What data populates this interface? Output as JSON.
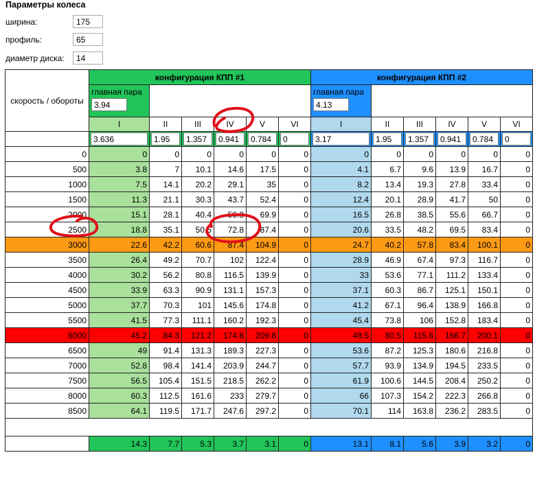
{
  "wheel_params": {
    "title": "Параметры колеса",
    "fields": [
      {
        "label": "ширина:",
        "value": "175"
      },
      {
        "label": "профиль:",
        "value": "65"
      },
      {
        "label": "диаметр диска:",
        "value": "14"
      }
    ]
  },
  "table": {
    "speed_rpm_label": "скорость / обороты",
    "configs": [
      {
        "title": "конфигурация КПП #1",
        "main_pair_label": "главная пара",
        "main_pair": "3.94",
        "gears": [
          "I",
          "II",
          "III",
          "IV",
          "V",
          "VI"
        ],
        "ratios": [
          "3.636",
          "1.95",
          "1.357",
          "0.941",
          "0.784",
          "0"
        ],
        "color": "#22c55a",
        "light_color": "#a9e09c"
      },
      {
        "title": "конфигурация КПП #2",
        "main_pair_label": "главная пара",
        "main_pair": "4.13",
        "gears": [
          "I",
          "II",
          "III",
          "IV",
          "V",
          "VI"
        ],
        "ratios": [
          "3.17",
          "1.95",
          "1.357",
          "0.941",
          "0.784",
          "0"
        ],
        "color": "#1e90ff",
        "light_color": "#b0d9ee"
      }
    ],
    "rows": [
      {
        "rpm": "0",
        "c1": [
          "0",
          "0",
          "0",
          "0",
          "0",
          "0"
        ],
        "c2": [
          "0",
          "0",
          "0",
          "0",
          "0",
          "0"
        ]
      },
      {
        "rpm": "500",
        "c1": [
          "3.8",
          "7",
          "10.1",
          "14.6",
          "17.5",
          "0"
        ],
        "c2": [
          "4.1",
          "6.7",
          "9.6",
          "13.9",
          "16.7",
          "0"
        ]
      },
      {
        "rpm": "1000",
        "c1": [
          "7.5",
          "14.1",
          "20.2",
          "29.1",
          "35",
          "0"
        ],
        "c2": [
          "8.2",
          "13.4",
          "19.3",
          "27.8",
          "33.4",
          "0"
        ]
      },
      {
        "rpm": "1500",
        "c1": [
          "11.3",
          "21.1",
          "30.3",
          "43.7",
          "52.4",
          "0"
        ],
        "c2": [
          "12.4",
          "20.1",
          "28.9",
          "41.7",
          "50",
          "0"
        ]
      },
      {
        "rpm": "2000",
        "c1": [
          "15.1",
          "28.1",
          "40.4",
          "58.3",
          "69.9",
          "0"
        ],
        "c2": [
          "16.5",
          "26.8",
          "38.5",
          "55.6",
          "66.7",
          "0"
        ]
      },
      {
        "rpm": "2500",
        "c1": [
          "18.8",
          "35.1",
          "50.5",
          "72.8",
          "87.4",
          "0"
        ],
        "c2": [
          "20.6",
          "33.5",
          "48.2",
          "69.5",
          "83.4",
          "0"
        ]
      },
      {
        "rpm": "3000",
        "highlight": "orange",
        "c1": [
          "22.6",
          "42.2",
          "60.6",
          "87.4",
          "104.9",
          "0"
        ],
        "c2": [
          "24.7",
          "40.2",
          "57.8",
          "83.4",
          "100.1",
          "0"
        ]
      },
      {
        "rpm": "3500",
        "c1": [
          "26.4",
          "49.2",
          "70.7",
          "102",
          "122.4",
          "0"
        ],
        "c2": [
          "28.9",
          "46.9",
          "67.4",
          "97.3",
          "116.7",
          "0"
        ]
      },
      {
        "rpm": "4000",
        "c1": [
          "30.2",
          "56.2",
          "80.8",
          "116.5",
          "139.9",
          "0"
        ],
        "c2": [
          "33",
          "53.6",
          "77.1",
          "111.2",
          "133.4",
          "0"
        ]
      },
      {
        "rpm": "4500",
        "c1": [
          "33.9",
          "63.3",
          "90.9",
          "131.1",
          "157.3",
          "0"
        ],
        "c2": [
          "37.1",
          "60.3",
          "86.7",
          "125.1",
          "150.1",
          "0"
        ]
      },
      {
        "rpm": "5000",
        "c1": [
          "37.7",
          "70.3",
          "101",
          "145.6",
          "174.8",
          "0"
        ],
        "c2": [
          "41.2",
          "67.1",
          "96.4",
          "138.9",
          "166.8",
          "0"
        ]
      },
      {
        "rpm": "5500",
        "c1": [
          "41.5",
          "77.3",
          "111.1",
          "160.2",
          "192.3",
          "0"
        ],
        "c2": [
          "45.4",
          "73.8",
          "106",
          "152.8",
          "183.4",
          "0"
        ]
      },
      {
        "rpm": "6000",
        "highlight": "red",
        "c1": [
          "45.2",
          "84.3",
          "121.2",
          "174.8",
          "209.8",
          "0"
        ],
        "c2": [
          "49.5",
          "80.5",
          "115.6",
          "166.7",
          "200.1",
          "0"
        ]
      },
      {
        "rpm": "6500",
        "c1": [
          "49",
          "91.4",
          "131.3",
          "189.3",
          "227.3",
          "0"
        ],
        "c2": [
          "53.6",
          "87.2",
          "125.3",
          "180.6",
          "216.8",
          "0"
        ]
      },
      {
        "rpm": "7000",
        "c1": [
          "52.8",
          "98.4",
          "141.4",
          "203.9",
          "244.7",
          "0"
        ],
        "c2": [
          "57.7",
          "93.9",
          "134.9",
          "194.5",
          "233.5",
          "0"
        ]
      },
      {
        "rpm": "7500",
        "c1": [
          "56.5",
          "105.4",
          "151.5",
          "218.5",
          "262.2",
          "0"
        ],
        "c2": [
          "61.9",
          "100.6",
          "144.5",
          "208.4",
          "250.2",
          "0"
        ]
      },
      {
        "rpm": "8000",
        "c1": [
          "60.3",
          "112.5",
          "161.6",
          "233",
          "279.7",
          "0"
        ],
        "c2": [
          "66",
          "107.3",
          "154.2",
          "222.3",
          "266.8",
          "0"
        ]
      },
      {
        "rpm": "8500",
        "c1": [
          "64.1",
          "119.5",
          "171.7",
          "247.6",
          "297.2",
          "0"
        ],
        "c2": [
          "70.1",
          "114",
          "163.8",
          "236.2",
          "283.5",
          "0"
        ]
      }
    ],
    "footer": {
      "c1": [
        "14.3",
        "7.7",
        "5.3",
        "3.7",
        "3.1",
        "0"
      ],
      "c2": [
        "13.1",
        "8.1",
        "5.6",
        "3.9",
        "3.2",
        "0"
      ]
    }
  }
}
